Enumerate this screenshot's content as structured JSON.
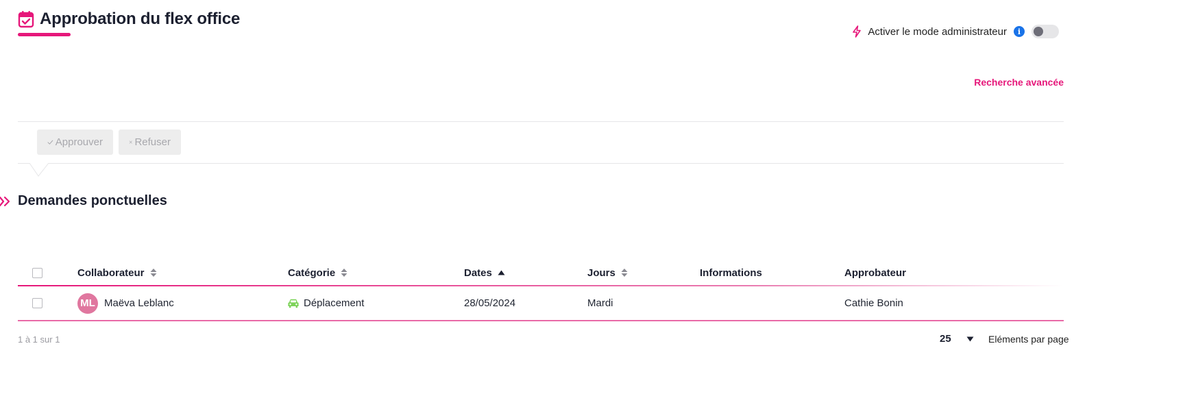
{
  "header": {
    "title": "Approbation du flex office",
    "title_icon": "calendar-check-icon",
    "accent_color": "#e6177a"
  },
  "admin_mode": {
    "label": "Activer le mode administrateur",
    "icon": "bolt-icon",
    "info_icon": "info-icon",
    "info_glyph": "i",
    "enabled": false
  },
  "advanced_search": {
    "label": "Recherche avancée"
  },
  "toolbar": {
    "approve_label": "Approuver",
    "refuse_label": "Refuser"
  },
  "section": {
    "title": "Demandes ponctuelles"
  },
  "table": {
    "columns": [
      {
        "label": "Collaborateur",
        "sort": "none"
      },
      {
        "label": "Catégorie",
        "sort": "none"
      },
      {
        "label": "Dates",
        "sort": "asc"
      },
      {
        "label": "Jours",
        "sort": "none"
      },
      {
        "label": "Informations",
        "sort": null
      },
      {
        "label": "Approbateur",
        "sort": null
      }
    ],
    "rows": [
      {
        "checked": false,
        "avatar_initials": "ML",
        "avatar_color": "#e0779f",
        "collaborateur": "Maëva Leblanc",
        "categorie": "Déplacement",
        "categorie_icon": "car-icon",
        "categorie_color": "#7dd35a",
        "dates": "28/05/2024",
        "jours": "Mardi",
        "informations": "",
        "approbateur": "Cathie Bonin"
      }
    ]
  },
  "pagination": {
    "range_text": "1 à 1 sur 1",
    "page_size": "25",
    "per_page_label": "Eléments par page"
  }
}
